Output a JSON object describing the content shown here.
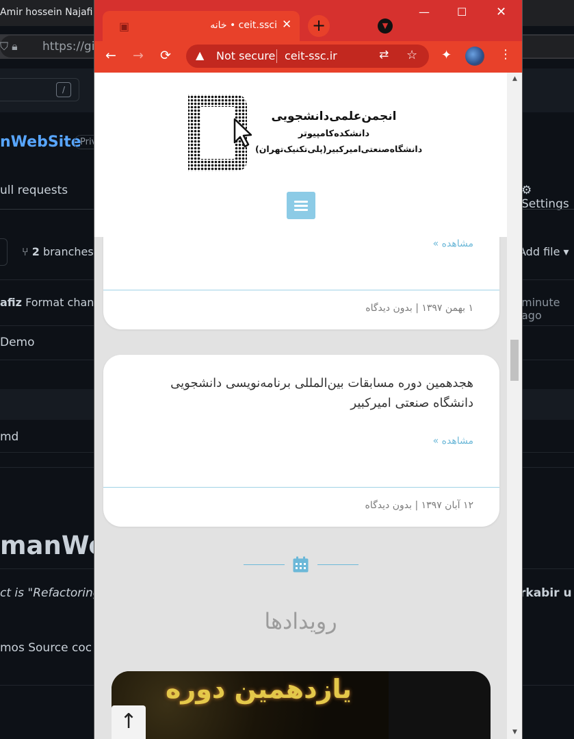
{
  "background": {
    "tab_title": "Amir hossein Najafi z",
    "url_text": "https://gi",
    "slash_key": "/",
    "repo_name": "nWebSite",
    "repo_visibility": "Priv",
    "nav_pulls": "ull requests",
    "nav_settings": "Settings",
    "branches_count": "2",
    "branches_label": "branches",
    "add_file": "Add file",
    "commit_author": "afiz",
    "commit_msg": "Format chang",
    "commit_time": "minute ago",
    "file_demo": "Demo",
    "file_md": "md",
    "readme_title": "manWel",
    "readme_desc": "ct is \"Refactoring",
    "readme_desc_right": "rkabir u",
    "readme_demos": "mos Source coc"
  },
  "popup": {
    "tab_title": "خانه • ceit.ssci",
    "tab_close": "✕",
    "new_tab": "+",
    "tab_search": "▼",
    "minimize": "—",
    "maximize": "☐",
    "close": "✕",
    "back": "←",
    "forward": "→",
    "reload": "⟳",
    "warning": "▲",
    "not_secure": "Not secure",
    "domain": "ceit-ssc.ir",
    "translate": "⇄",
    "star": "☆",
    "extensions": "✦",
    "more": "⋮"
  },
  "site": {
    "logo_line1": "انجمن‌علمی‌دانشجویی",
    "logo_line2": "دانشکده‌کامپیوتر",
    "logo_line3": "دانشگاه‌صنعتی‌امیرکبیر(پلی‌تکنیک‌تهران)",
    "posts": [
      {
        "more": "مشاهده »",
        "meta": "۱ بهمن ۱۳۹۷   |   بدون دیدگاه"
      },
      {
        "title": "هجدهمین دوره مسابقات بین‌المللی برنامه‌نویسی دانشجویی دانشگاه صنعتی امیرکبیر",
        "more": "مشاهده »",
        "meta": "۱۲ آبان ۱۳۹۷   |   بدون دیدگاه"
      }
    ],
    "events_title": "رویدادها",
    "event_image_text": "یازدهمین دوره",
    "back_to_top": "↑"
  },
  "colors": {
    "titlebar": "#d6312e",
    "toolbar": "#e8412a",
    "accent": "#6cb8d8",
    "menu_button": "#8ccbe6"
  }
}
